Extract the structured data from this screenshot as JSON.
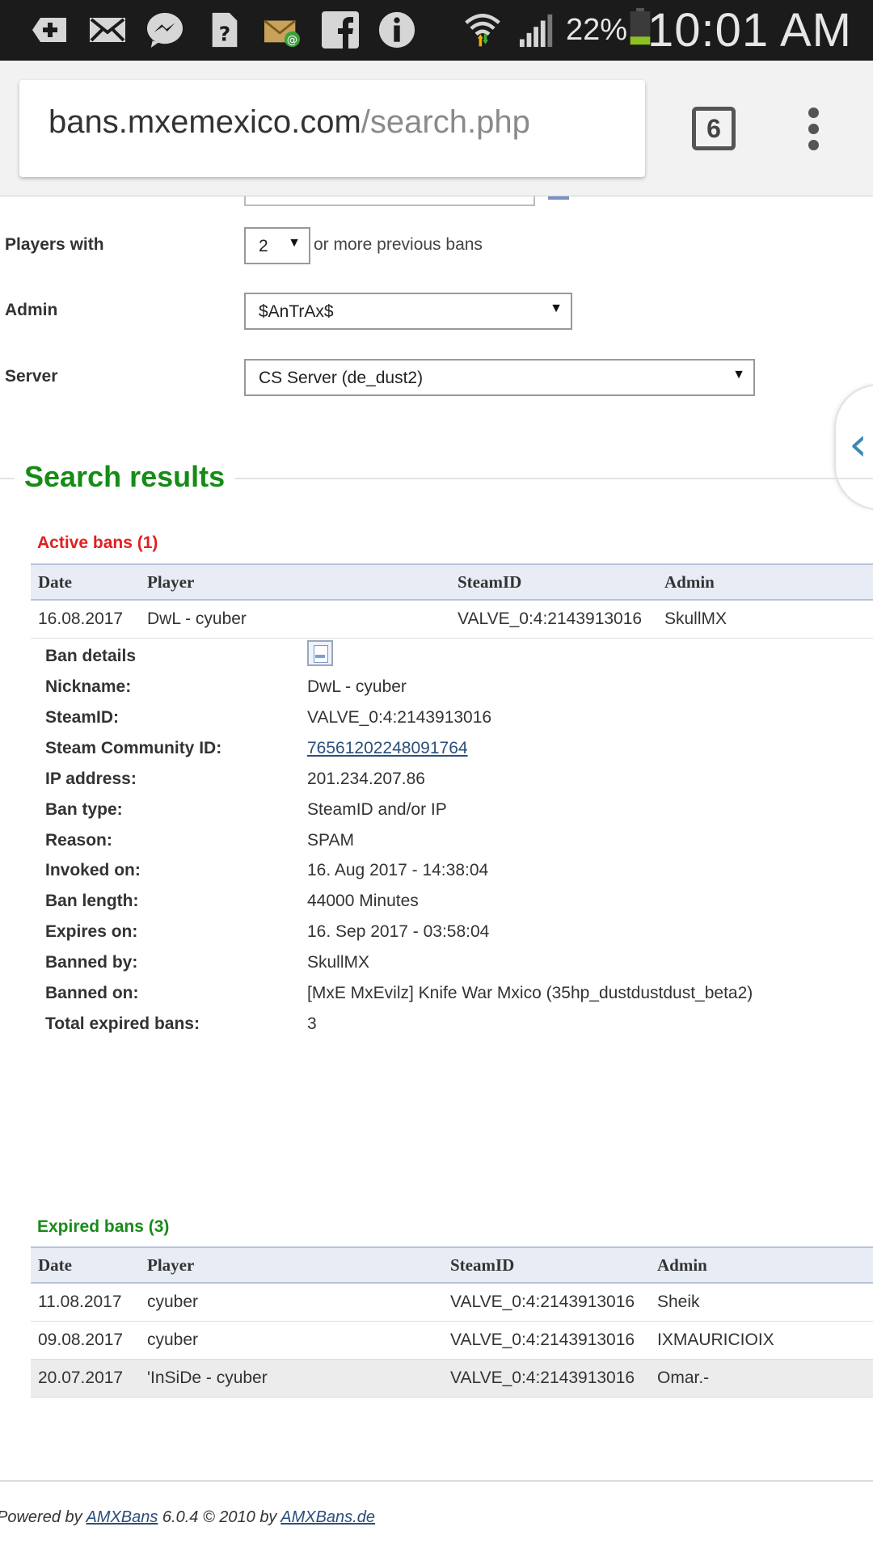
{
  "status_bar": {
    "battery": "22%",
    "time": "10:01 AM",
    "icons": [
      "add-icon",
      "mail-icon",
      "messenger-icon",
      "unknown-app-icon",
      "email-notification-icon",
      "facebook-icon",
      "info-icon",
      "wifi-icon",
      "signal-icon",
      "battery-icon"
    ]
  },
  "browser": {
    "url_host": "bans.mxemexico.com",
    "url_path": "/search.php",
    "tab_count": "6"
  },
  "filters": {
    "players_with_label": "Players with",
    "players_with_value": "2",
    "players_with_suffix": "or more previous bans",
    "admin_label": "Admin",
    "admin_value": "$AnTrAx$",
    "server_label": "Server",
    "server_value": "CS Server (de_dust2)"
  },
  "search_results_title": "Search results",
  "active_bans": {
    "title": "Active bans (1)",
    "columns": [
      "Date",
      "Player",
      "SteamID",
      "Admin"
    ],
    "rows": [
      [
        "16.08.2017",
        "DwL - cyuber",
        "VALVE_0:4:2143913016",
        "SkullMX"
      ]
    ]
  },
  "ban_details": {
    "heading": "Ban details",
    "rows": [
      {
        "label": "Nickname:",
        "value": "DwL - cyuber"
      },
      {
        "label": "SteamID:",
        "value": "VALVE_0:4:2143913016"
      },
      {
        "label": "Steam Community ID:",
        "value": "76561202248091764"
      },
      {
        "label": "IP address:",
        "value": "201.234.207.86"
      },
      {
        "label": "Ban type:",
        "value": "SteamID and/or IP"
      },
      {
        "label": "Reason:",
        "value": "SPAM"
      },
      {
        "label": "Invoked on:",
        "value": "16. Aug 2017 - 14:38:04"
      },
      {
        "label": "Ban length:",
        "value": "44000 Minutes"
      },
      {
        "label": "Expires on:",
        "value": "16. Sep 2017 - 03:58:04"
      },
      {
        "label": "Banned by:",
        "value": "SkullMX"
      },
      {
        "label": "Banned on:",
        "value": "[MxE MxEvilz] Knife War Mxico (35hp_dustdustdust_beta2)"
      },
      {
        "label": "Total expired bans:",
        "value": "3"
      }
    ]
  },
  "expired_bans": {
    "title": "Expired bans (3)",
    "columns": [
      "Date",
      "Player",
      "SteamID",
      "Admin"
    ],
    "rows": [
      [
        "11.08.2017",
        "cyuber",
        "VALVE_0:4:2143913016",
        "Sheik"
      ],
      [
        "09.08.2017",
        "cyuber",
        "VALVE_0:4:2143913016",
        "IXMAURICIOIX"
      ],
      [
        "20.07.2017",
        "'InSiDe - cyuber",
        "VALVE_0:4:2143913016",
        "Omar.-"
      ]
    ]
  },
  "footer": {
    "prefix": "Powered by ",
    "link1": "AMXBans",
    "middle": " 6.0.4 © 2010 by ",
    "link2": "AMXBans.de"
  }
}
